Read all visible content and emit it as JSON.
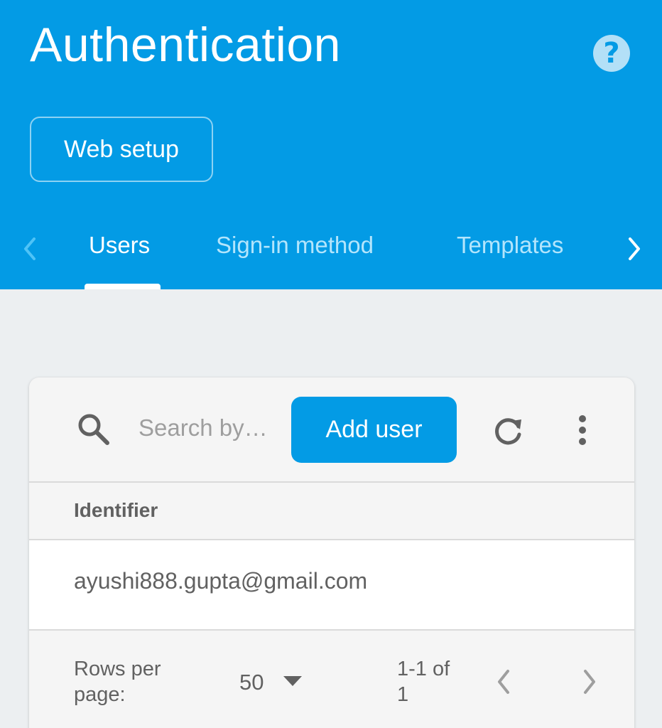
{
  "header": {
    "title": "Authentication",
    "help_glyph": "?",
    "web_setup_label": "Web setup",
    "tabs": [
      {
        "label": "Users",
        "active": true
      },
      {
        "label": "Sign-in method",
        "active": false
      },
      {
        "label": "Templates",
        "active": false
      }
    ],
    "icons": {
      "help": "help-icon",
      "tabs_prev": "chevron-left-icon",
      "tabs_next": "chevron-right-icon"
    }
  },
  "toolbar": {
    "search_placeholder": "Search by…",
    "add_user_label": "Add user",
    "icons": {
      "search": "search-icon",
      "refresh": "refresh-icon",
      "more": "more-vert-icon"
    }
  },
  "table": {
    "columns": [
      "Identifier"
    ],
    "rows": [
      {
        "identifier": "ayushi888.gupta@gmail.com"
      }
    ]
  },
  "pagination": {
    "rows_per_page_label_line1": "Rows per",
    "rows_per_page_label_line2": "page:",
    "rows_per_page_value": "50",
    "range_line1": "1-1 of",
    "range_line2": "1"
  },
  "colors": {
    "brand": "#039be5",
    "background": "#eceff1",
    "text_secondary": "#616161"
  }
}
